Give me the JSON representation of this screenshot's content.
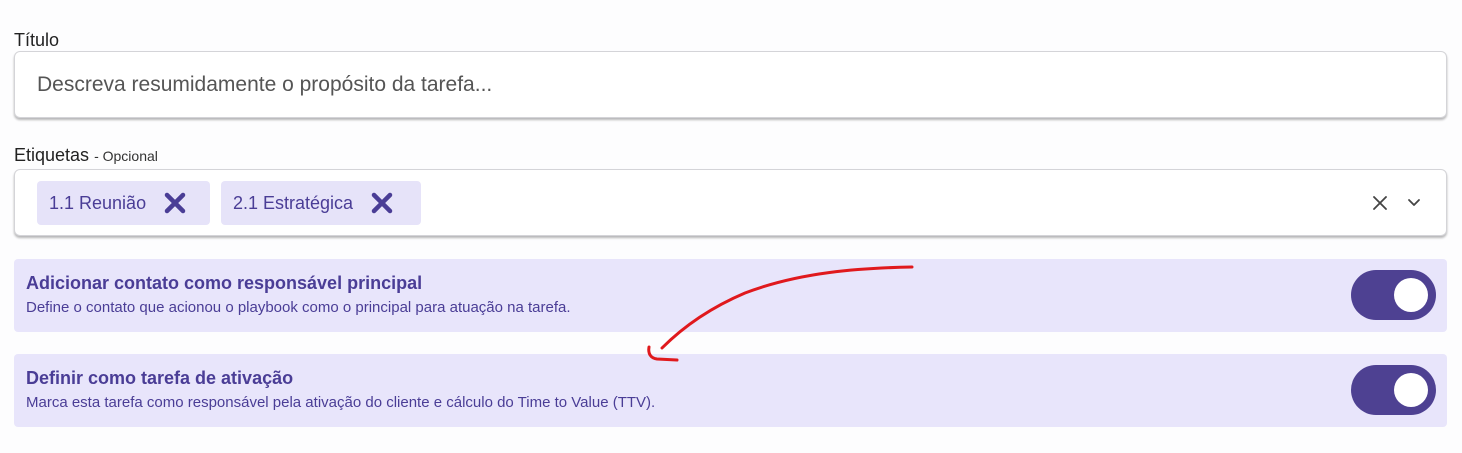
{
  "form": {
    "title": {
      "label": "Título",
      "placeholder": "Descreva resumidamente o propósito da tarefa..."
    },
    "tags": {
      "label": "Etiquetas",
      "optional_suffix": "- Opcional",
      "selected": [
        {
          "label": "1.1 Reunião",
          "remove_icon": "close-icon"
        },
        {
          "label": "2.1 Estratégica",
          "remove_icon": "close-icon"
        }
      ],
      "clear_icon": "close-icon",
      "expand_icon": "chevron-down-icon"
    },
    "options": [
      {
        "title": "Adicionar contato como responsável principal",
        "description": "Define o contato que acionou o playbook como o principal para atuação na tarefa.",
        "enabled": true
      },
      {
        "title": "Definir como tarefa de ativação",
        "description": "Marca esta tarefa como responsável pela ativação do cliente e cálculo do Time to Value (TTV).",
        "enabled": true
      }
    ]
  },
  "colors": {
    "accent": "#4e4192",
    "accent_text": "#4a3d96",
    "chip_bg": "#e6e3f9",
    "card_bg": "#e8e5fb",
    "annotation": "#e0191d"
  }
}
